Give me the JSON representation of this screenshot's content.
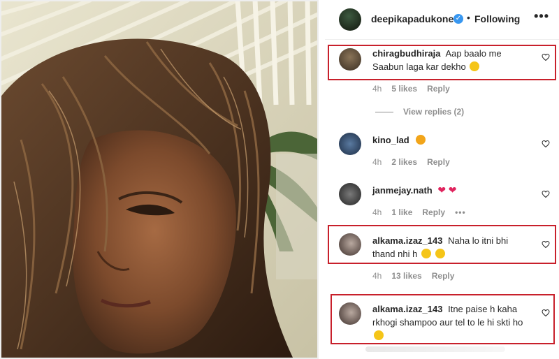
{
  "post": {
    "username": "deepikapadukone",
    "separator": "•",
    "follow_status": "Following",
    "more_label": "•••"
  },
  "comments": [
    {
      "username": "chiragbudhiraja",
      "text": "Aap baalo me Saabun laga kar dekho",
      "emoji": "grinning-squint-face",
      "time": "4h",
      "likes": "5 likes",
      "reply": "Reply",
      "view_replies": "View replies (2)",
      "highlighted": true,
      "avatar_color": "#5a4a3a"
    },
    {
      "username": "kino_lad",
      "text": "",
      "emoji": "star-struck-face",
      "time": "4h",
      "likes": "2 likes",
      "reply": "Reply",
      "highlighted": false,
      "avatar_color": "#2f4a6a"
    },
    {
      "username": "janmejay.nath",
      "text": "",
      "emoji": "two-red-hearts",
      "time": "4h",
      "likes": "1 like",
      "reply": "Reply",
      "more": "•••",
      "highlighted": false,
      "avatar_color": "#3b3b3b"
    },
    {
      "username": "alkama.izaz_143",
      "text": "Naha lo itni bhi thand nhi h",
      "emoji": "rolling-laughing-face, grinning-face",
      "time": "4h",
      "likes": "13 likes",
      "reply": "Reply",
      "highlighted": true,
      "avatar_color": "#6b5a55"
    },
    {
      "username": "alkama.izaz_143",
      "text": "Itne paise h kaha rkhogi shampoo aur tel to le hi skti ho",
      "emoji": "grinning-squint-face",
      "highlighted": true,
      "avatar_color": "#6b5a55"
    }
  ],
  "colors": {
    "highlight_border": "#c8202b",
    "verified": "#3897f0",
    "meta_text": "#8e8e8e"
  },
  "icons": {
    "verified": "verified-badge-icon",
    "heart": "heart-outline-icon",
    "more": "more-horizontal-icon"
  }
}
